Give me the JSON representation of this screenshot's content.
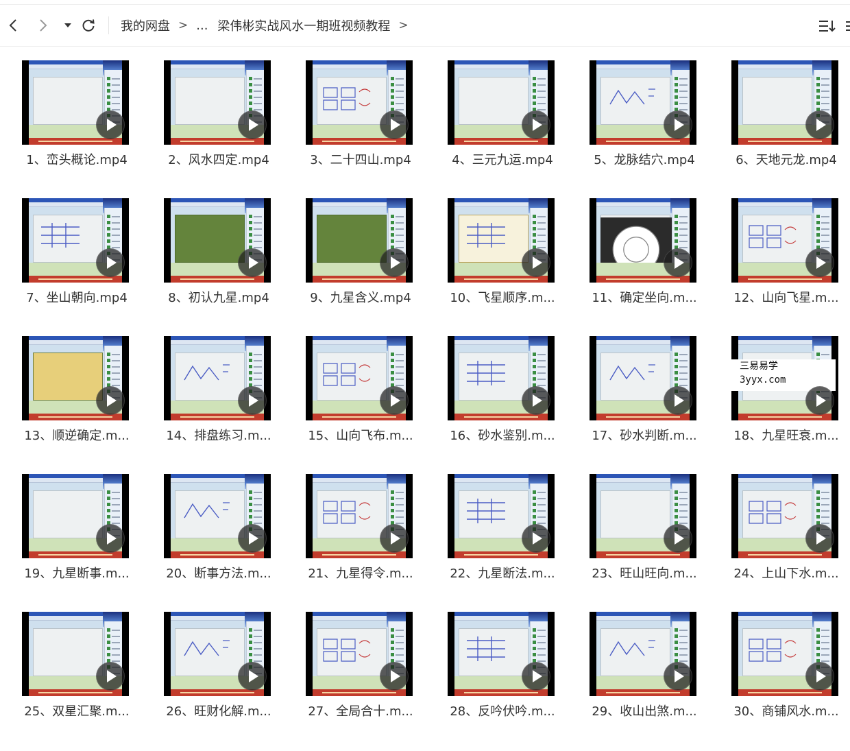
{
  "toolbar": {
    "breadcrumbs": [
      "我的网盘",
      "...",
      "梁伟彬实战风水一期班视频教程"
    ]
  },
  "watermark": {
    "line1": "三易易学",
    "line2": "3yyx.com"
  },
  "colors": {
    "accent": "#2c55b6",
    "thumbnail_bg": "#000000",
    "play_overlay": "#1e1e1e"
  },
  "files": [
    {
      "name": "1、峦头概论.mp4",
      "style": "plain"
    },
    {
      "name": "2、风水四定.mp4",
      "style": "plain"
    },
    {
      "name": "3、二十四山.mp4",
      "style": "sketch"
    },
    {
      "name": "4、三元九运.mp4",
      "style": "plain"
    },
    {
      "name": "5、龙脉结穴.mp4",
      "style": "sketch"
    },
    {
      "name": "6、天地元龙.mp4",
      "style": "plain"
    },
    {
      "name": "7、坐山朝向.mp4",
      "style": "sketch"
    },
    {
      "name": "8、初认九星.mp4",
      "style": "green"
    },
    {
      "name": "9、九星含义.mp4",
      "style": "green"
    },
    {
      "name": "10、飞星顺序.m...",
      "style": "gold"
    },
    {
      "name": "11、确定坐向.m...",
      "style": "dark"
    },
    {
      "name": "12、山向飞星.m...",
      "style": "sketch"
    },
    {
      "name": "13、顺逆确定.m...",
      "style": "yellow"
    },
    {
      "name": "14、排盘练习.m...",
      "style": "sketch"
    },
    {
      "name": "15、山向飞布.m...",
      "style": "sketch"
    },
    {
      "name": "16、砂水鉴别.m...",
      "style": "sketch"
    },
    {
      "name": "17、砂水判断.m...",
      "style": "sketch"
    },
    {
      "name": "18、九星旺衰.m...",
      "style": "watermark"
    },
    {
      "name": "19、九星断事.m...",
      "style": "plain"
    },
    {
      "name": "20、断事方法.m...",
      "style": "sketch"
    },
    {
      "name": "21、九星得令.m...",
      "style": "sketch"
    },
    {
      "name": "22、九星断法.m...",
      "style": "sketch"
    },
    {
      "name": "23、旺山旺向.m...",
      "style": "plain"
    },
    {
      "name": "24、上山下水.m...",
      "style": "sketch"
    },
    {
      "name": "25、双星汇聚.m...",
      "style": "plain"
    },
    {
      "name": "26、旺财化解.m...",
      "style": "sketch"
    },
    {
      "name": "27、全局合十.m...",
      "style": "sketch"
    },
    {
      "name": "28、反吟伏吟.m...",
      "style": "sketch"
    },
    {
      "name": "29、收山出煞.m...",
      "style": "sketch"
    },
    {
      "name": "30、商铺风水.m...",
      "style": "sketch"
    }
  ]
}
